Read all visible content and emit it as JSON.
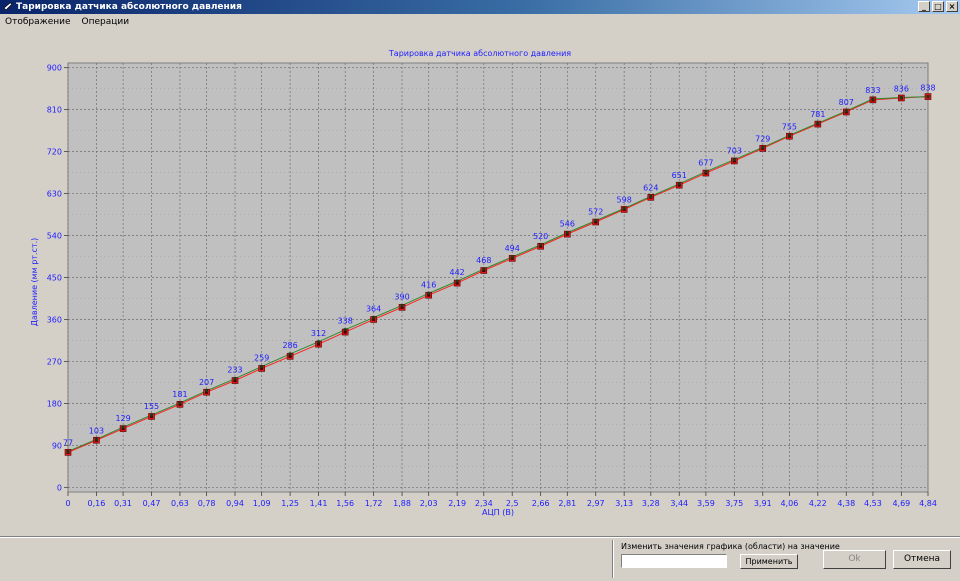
{
  "window": {
    "title": "Тарировка датчика абсолютного давления",
    "controls": {
      "minimize": "_",
      "maximize": "□",
      "close": "×"
    }
  },
  "menu": [
    "Отображение",
    "Операции"
  ],
  "chart_data": {
    "type": "line",
    "title": "Тарировка датчика абсолютного давления",
    "xlabel": "АЦП (В)",
    "ylabel": "Давление (мм рт.ст.)",
    "xlim": [
      0,
      4.84
    ],
    "ylim": [
      -10,
      910
    ],
    "grid": true,
    "x_ticks": [
      "0",
      "0,16",
      "0,31",
      "0,47",
      "0,63",
      "0,78",
      "0,94",
      "1,09",
      "1,25",
      "1,41",
      "1,56",
      "1,72",
      "1,88",
      "2,03",
      "2,19",
      "2,34",
      "2,5",
      "2,66",
      "2,81",
      "2,97",
      "3,13",
      "3,28",
      "3,44",
      "3,59",
      "3,75",
      "3,91",
      "4,06",
      "4,22",
      "4,38",
      "4,53",
      "4,69",
      "4,84"
    ],
    "y_ticks": [
      0,
      90,
      180,
      270,
      360,
      450,
      540,
      630,
      720,
      810,
      900
    ],
    "x": [
      0,
      0.16,
      0.31,
      0.47,
      0.63,
      0.78,
      0.94,
      1.09,
      1.25,
      1.41,
      1.56,
      1.72,
      1.88,
      2.03,
      2.19,
      2.34,
      2.5,
      2.66,
      2.81,
      2.97,
      3.13,
      3.28,
      3.44,
      3.59,
      3.75,
      3.91,
      4.06,
      4.22,
      4.38,
      4.53,
      4.69,
      4.84
    ],
    "point_labels": [
      "77",
      "103",
      "129",
      "155",
      "181",
      "207",
      "233",
      "259",
      "286",
      "312",
      "338",
      "364",
      "390",
      "416",
      "442",
      "468",
      "494",
      "520",
      "546",
      "572",
      "598",
      "624",
      "651",
      "677",
      "703",
      "729",
      "755",
      "781",
      "807",
      "833",
      "836",
      "838"
    ],
    "series": [
      {
        "color": "#2e8b2e",
        "values": [
          77,
          103,
          129,
          155,
          181,
          207,
          233,
          259,
          286,
          312,
          338,
          364,
          390,
          416,
          442,
          468,
          494,
          520,
          546,
          572,
          598,
          624,
          651,
          677,
          703,
          729,
          755,
          781,
          807,
          833,
          836,
          838
        ]
      },
      {
        "color": "#ff2020",
        "values": [
          75,
          101,
          126,
          152,
          178,
          204,
          229,
          255,
          281,
          307,
          333,
          360,
          386,
          412,
          438,
          465,
          491,
          517,
          543,
          569,
          596,
          622,
          648,
          674,
          700,
          727,
          753,
          779,
          805,
          831,
          835,
          838
        ]
      }
    ],
    "label_color": "#2020ff",
    "plot_bg": "#c0c0c0"
  },
  "bottom": {
    "change_label": "Изменить значения графика (области) на значение",
    "value": "",
    "apply": "Применить",
    "ok": "Ok",
    "cancel": "Отмена"
  }
}
